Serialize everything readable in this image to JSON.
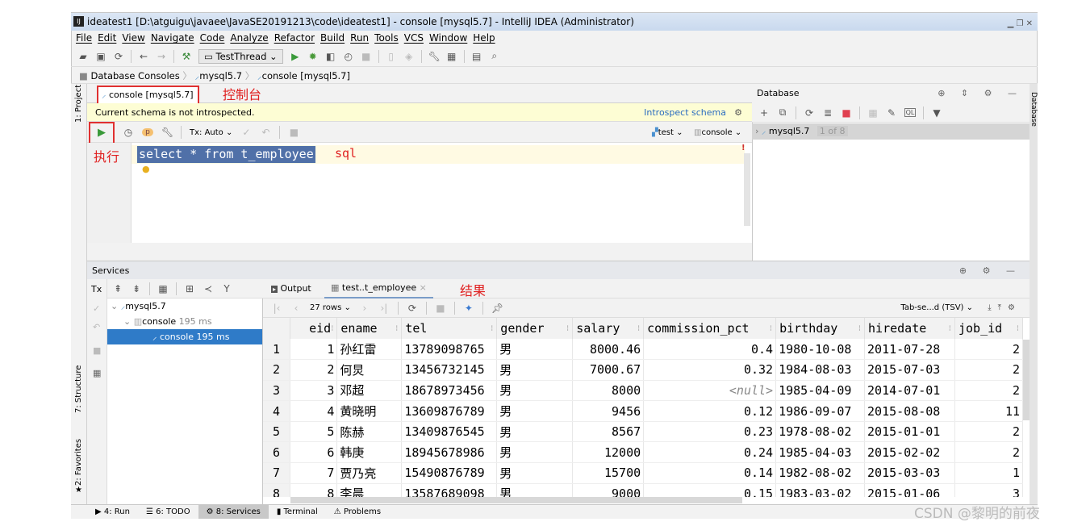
{
  "window": {
    "title": "ideatest1 [D:\\atguigu\\javaee\\JavaSE20191213\\code\\ideatest1] - console [mysql5.7] - IntelliJ IDEA (Administrator)"
  },
  "menu": [
    "File",
    "Edit",
    "View",
    "Navigate",
    "Code",
    "Analyze",
    "Refactor",
    "Build",
    "Run",
    "Tools",
    "VCS",
    "Window",
    "Help"
  ],
  "toolbar": {
    "run_config": "TestThread"
  },
  "breadcrumb": [
    "Database Consoles",
    "mysql5.7",
    "console [mysql5.7]"
  ],
  "editor": {
    "tab_label": "console [mysql5.7]",
    "annotation_tab": "控制台",
    "notice": "Current schema is not introspected.",
    "introspect_link": "Introspect schema",
    "tx_mode": "Tx: Auto",
    "schema": "test",
    "session": "console",
    "annotation_run": "执行",
    "line_number": "1",
    "sql": "select * from t_employee",
    "annotation_sql": "sql"
  },
  "left_strip": {
    "project": "1: Project",
    "structure": "7: Structure",
    "favorites": "2: Favorites"
  },
  "database": {
    "title": "Database",
    "tree_item": "mysql5.7",
    "tree_badge": "1 of 8",
    "strip_label": "Database"
  },
  "services": {
    "title": "Services",
    "tx": "Tx",
    "tree": [
      {
        "label": "mysql5.7",
        "time": ""
      },
      {
        "label": "console",
        "time": "195 ms"
      },
      {
        "label": "console",
        "time": "195 ms"
      }
    ]
  },
  "results": {
    "tab_output": "Output",
    "tab_table": "test..t_employee",
    "annotation": "结果",
    "rows_label": "27 rows",
    "export_format": "Tab-se...d (TSV)",
    "columns": [
      "eid",
      "ename",
      "tel",
      "gender",
      "salary",
      "commission_pct",
      "birthday",
      "hiredate",
      "job_id"
    ],
    "rows": [
      [
        "1",
        "1",
        "孙红雷",
        "13789098765",
        "男",
        "8000.46",
        "0.4",
        "1980-10-08",
        "2011-07-28",
        "2"
      ],
      [
        "2",
        "2",
        "何炅",
        "13456732145",
        "男",
        "7000.67",
        "0.32",
        "1984-08-03",
        "2015-07-03",
        "2"
      ],
      [
        "3",
        "3",
        "邓超",
        "18678973456",
        "男",
        "8000",
        "<null>",
        "1985-04-09",
        "2014-07-01",
        "2"
      ],
      [
        "4",
        "4",
        "黄晓明",
        "13609876789",
        "男",
        "9456",
        "0.12",
        "1986-09-07",
        "2015-08-08",
        "11"
      ],
      [
        "5",
        "5",
        "陈赫",
        "13409876545",
        "男",
        "8567",
        "0.23",
        "1978-08-02",
        "2015-01-01",
        "2"
      ],
      [
        "6",
        "6",
        "韩庚",
        "18945678986",
        "男",
        "12000",
        "0.24",
        "1985-04-03",
        "2015-02-02",
        "2"
      ],
      [
        "7",
        "7",
        "贾乃亮",
        "15490876789",
        "男",
        "15700",
        "0.14",
        "1982-08-02",
        "2015-03-03",
        "1"
      ],
      [
        "8",
        "8",
        "李晨",
        "13587689098",
        "男",
        "9000",
        "0.15",
        "1983-03-02",
        "2015-01-06",
        "3"
      ]
    ]
  },
  "bottom_tools": [
    "4: Run",
    "6: TODO",
    "8: Services",
    "Terminal",
    "Problems"
  ],
  "watermark": "CSDN @黎明的前夜"
}
